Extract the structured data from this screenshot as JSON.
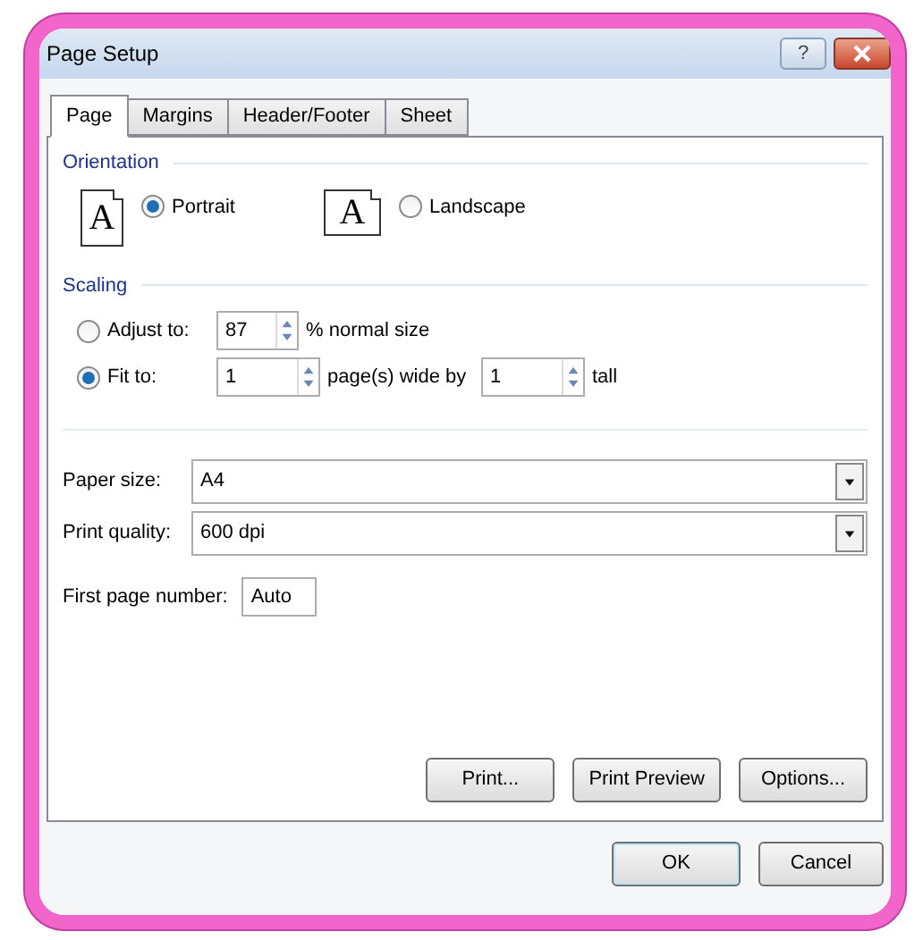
{
  "window": {
    "title": "Page Setup",
    "help_button": "?"
  },
  "tabs": [
    {
      "label": "Page",
      "selected": true
    },
    {
      "label": "Margins",
      "selected": false
    },
    {
      "label": "Header/Footer",
      "selected": false
    },
    {
      "label": "Sheet",
      "selected": false
    }
  ],
  "orientation": {
    "title": "Orientation",
    "options": [
      {
        "label": "Portrait",
        "selected": true,
        "icon_letter": "A",
        "kind": "portrait"
      },
      {
        "label": "Landscape",
        "selected": false,
        "icon_letter": "A",
        "kind": "landscape"
      }
    ]
  },
  "scaling": {
    "title": "Scaling",
    "adjust": {
      "label": "Adjust to:",
      "selected": false,
      "value": "87",
      "suffix": "% normal size"
    },
    "fit": {
      "label": "Fit to:",
      "selected": true,
      "wide_value": "1",
      "wide_suffix": "page(s) wide by",
      "tall_value": "1",
      "tall_suffix": "tall"
    }
  },
  "paper_size": {
    "label": "Paper size:",
    "value": "A4"
  },
  "print_quality": {
    "label": "Print quality:",
    "value": "600 dpi"
  },
  "first_page_number": {
    "label": "First page number:",
    "value": "Auto"
  },
  "panel_buttons": [
    "Print...",
    "Print Preview",
    "Options..."
  ],
  "buttons": [
    {
      "label": "OK",
      "kind": "default"
    },
    {
      "label": "Cancel",
      "kind": "normal"
    }
  ]
}
